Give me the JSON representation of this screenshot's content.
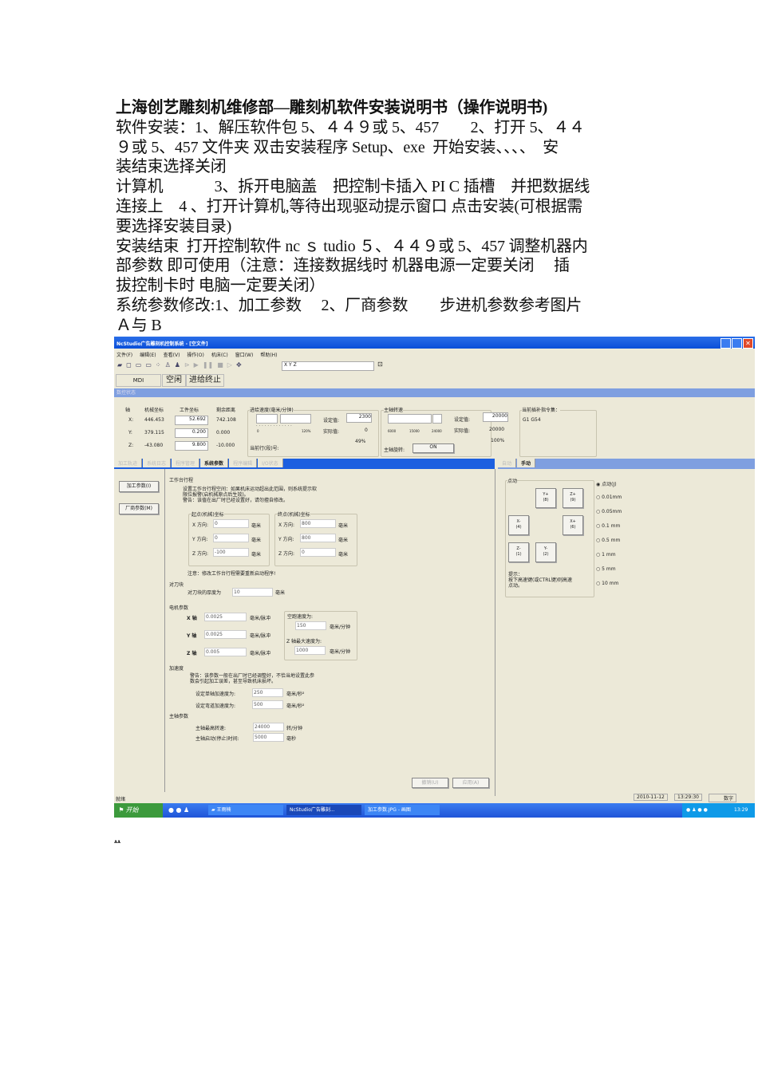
{
  "doc": {
    "lines": [
      "上海创艺雕刻机维修部—雕刻机软件安装说明书（操作说明书)",
      "软件安装：1、解压软件包 5、４４９或 5、457　　2、打开 5、４４",
      "９或 5、457 文件夹 双击安装程序 Setup、exe  开始安装、、、、  安",
      "装结束选择关闭",
      "计算机　　　 3、拆开电脑盖　把控制卡插入 PI C 插槽　并把数据线",
      "连接上　4 、打开计算机,等待出现驱动提示窗口 点击安装(可根据需",
      "要选择安装目录)",
      "安装结束  打开控制软件 nc ｓ tudio ５、４４９或 5、457 调整机器内",
      "部参数 即可使用（注意：连接数据线时 机器电源一定要关闭　 插",
      "拔控制卡时 电脑一定要关闭）",
      "系统参数修改:1、加工参数　 2、厂商参数　　步进机参数参考图片",
      "Ａ与 B"
    ],
    "footer_mark": "ѧѧ"
  },
  "app": {
    "title": "NcStudio广告雕刻机控制系统  - [空文件]",
    "menu": [
      "文件(F)",
      "编辑(E)",
      "查看(V)",
      "操作(O)",
      "机床(C)",
      "窗口(W)",
      "帮助(H)"
    ],
    "coord_input": "X      Y      Z",
    "mode": "MDI",
    "state": "空闲",
    "feed_state": "进给终止",
    "status_title": "数控状态",
    "axis_headers": [
      "轴",
      "机械坐标",
      "工件坐标",
      "剩余距离"
    ],
    "axes": [
      {
        "n": "X:",
        "m": "446.453",
        "w": "52.692",
        "r": "742.108"
      },
      {
        "n": "Y:",
        "m": "379.115",
        "w": "0.200",
        "r": "0.000"
      },
      {
        "n": "Z:",
        "m": "-43.080",
        "w": "9.800",
        "r": "-10.000"
      }
    ],
    "feed": {
      "title": "进给速度(毫米/分钟)",
      "set_label": "设定值:",
      "set": "2300",
      "act_label": "实际值:",
      "act": "0",
      "pct": "49%",
      "scale_min": "0",
      "scale_max": "120%",
      "line_label": "当前行(段)号:"
    },
    "spindle": {
      "title": "主轴转速",
      "set_label": "设定值:",
      "set": "20000",
      "act_label": "实际值:",
      "act": "20000",
      "pct": "100%",
      "ticks": [
        "6000",
        "15000",
        "24000"
      ],
      "rot_label": "主轴旋转:",
      "rot": "ON"
    },
    "gcode": {
      "title": "当前插补指令集：",
      "value": "G1 G54"
    },
    "tabs": [
      "加工轨迹",
      "系统日志",
      "程序管理",
      "系统参数",
      "程序编辑",
      "I/O状态"
    ],
    "side": [
      "加工参数(I)",
      "厂商参数(M)"
    ],
    "table_travel": {
      "title": "工作台行程",
      "note1": "设置工作台行程空间：如果机床运动超出此范围，则系统提示软",
      "note2": "限位报警(启机械原点后生效)。",
      "note3": "警告：该值在出厂时已经设置好，请勿擅自修改。",
      "start_title": "起点(机械)坐标",
      "end_title": "终点(机械)坐标",
      "labels": [
        "X 方向:",
        "Y 方向:",
        "Z 方向:"
      ],
      "start": [
        "0",
        "0",
        "-100"
      ],
      "end": [
        "800",
        "800",
        "0"
      ],
      "unit": "毫米",
      "warn": "注意：修改工作台行程需要重新启动程序!"
    },
    "tool": {
      "title": "对刀块",
      "label": "对刀块的厚度为",
      "value": "10",
      "unit": "毫米"
    },
    "motor": {
      "title": "电机参数",
      "labels": [
        "X 轴",
        "Y 轴",
        "Z 轴"
      ],
      "values": [
        "0.0025",
        "0.0025",
        "0.005"
      ],
      "unit": "毫米/脉冲",
      "idle_label": "空跑速度为:",
      "idle": "150",
      "zmax_label": "Z 轴最大速度为:",
      "zmax": "1000",
      "speed_unit": "毫米/分钟"
    },
    "accel": {
      "title": "加速度",
      "warn1": "警告：该参数一般在出厂时已经调整好，不恰当地设置此参",
      "warn2": "数会引起加工误差，甚至导致机床损坏。",
      "single_label": "设定单轴加速度为:",
      "single": "250",
      "curve_label": "设定弯道加速度为:",
      "curve": "500",
      "unit": "毫米/秒²"
    },
    "spindle_params": {
      "title": "主轴参数",
      "max_label": "主轴最高转速:",
      "max": "24000",
      "max_unit": "转/分钟",
      "delay_label": "主轴启动(停止)时间:",
      "delay": "5000",
      "delay_unit": "毫秒"
    },
    "buttons": [
      "撤销(U)",
      "应用(A)"
    ],
    "right_tabs": [
      "自动",
      "手动"
    ],
    "jog": {
      "title": "点动",
      "keys": [
        "Y+\n(8)",
        "Z+\n(9)",
        "X-\n(4)",
        "X+\n(6)",
        "Z-\n(1)",
        "Y-\n(2)"
      ],
      "hint1": "提示：",
      "hint2": "按下高速键(或CTRL键)则高速",
      "hint3": "点动。"
    },
    "steps": [
      "点动(J)",
      "0.01mm",
      "0.05mm",
      "0.1  mm",
      "0.5  mm",
      "1     mm",
      "5     mm",
      "10   mm"
    ],
    "statusbar": {
      "left": "就绪",
      "date": "2010-11-12",
      "time": "13:29:30",
      "mode": "数字"
    },
    "taskbar": {
      "start": "开始",
      "items": [
        "王雨楠",
        "NcStudio广告雕刻...",
        "加工参数.JPG - 画图"
      ],
      "clock": "13:29"
    }
  }
}
